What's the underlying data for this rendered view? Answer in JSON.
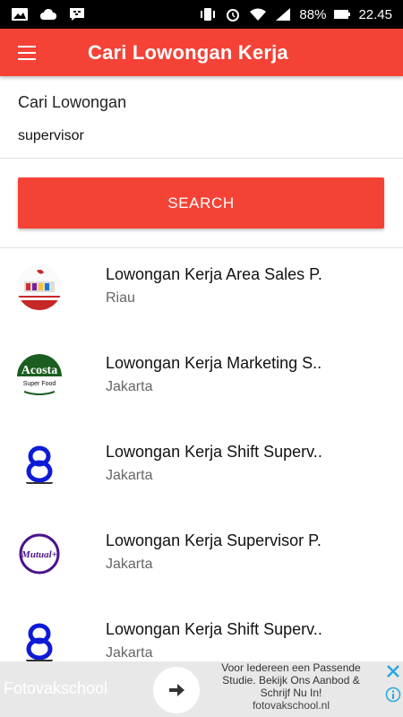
{
  "status_bar": {
    "battery": "88%",
    "time": "22.45",
    "left_icons": [
      "gallery-icon",
      "cloud-icon",
      "bbm-icon"
    ],
    "right_icons": [
      "vibrate-icon",
      "alarm-icon",
      "wifi-icon",
      "signal-icon",
      "battery-icon"
    ]
  },
  "app_bar": {
    "title": "Cari Lowongan Kerja",
    "menu_icon": "hamburger-icon",
    "color": "#f44336"
  },
  "search": {
    "label": "Cari Lowongan",
    "value": "supervisor",
    "button_label": "SEARCH"
  },
  "results": [
    {
      "title": "Lowongan Kerja Area Sales P.",
      "location": "Riau",
      "logo": "company-logo-red"
    },
    {
      "title": "Lowongan Kerja Marketing S..",
      "location": "Jakarta",
      "logo": "acosta-logo",
      "logo_text_1": "Acosta",
      "logo_text_2": "Super Food"
    },
    {
      "title": "Lowongan Kerja Shift Superv..",
      "location": "Jakarta",
      "logo": "eight-logo"
    },
    {
      "title": "Lowongan Kerja Supervisor P.",
      "location": "Jakarta",
      "logo": "mutual-logo",
      "logo_text_1": "Mutual+"
    },
    {
      "title": "Lowongan Kerja Shift Superv..",
      "location": "Jakarta",
      "logo": "eight-logo"
    }
  ],
  "ad": {
    "brand": "Fotovakschool",
    "text": "Voor Iedereen een Passende Studie. Bekijk Ons Aanbod & Schrijf Nu In!",
    "url": "fotovakschool.nl",
    "arrow_icon": "arrow-right-icon",
    "close_icon": "close-icon",
    "info_icon": "info-icon"
  }
}
